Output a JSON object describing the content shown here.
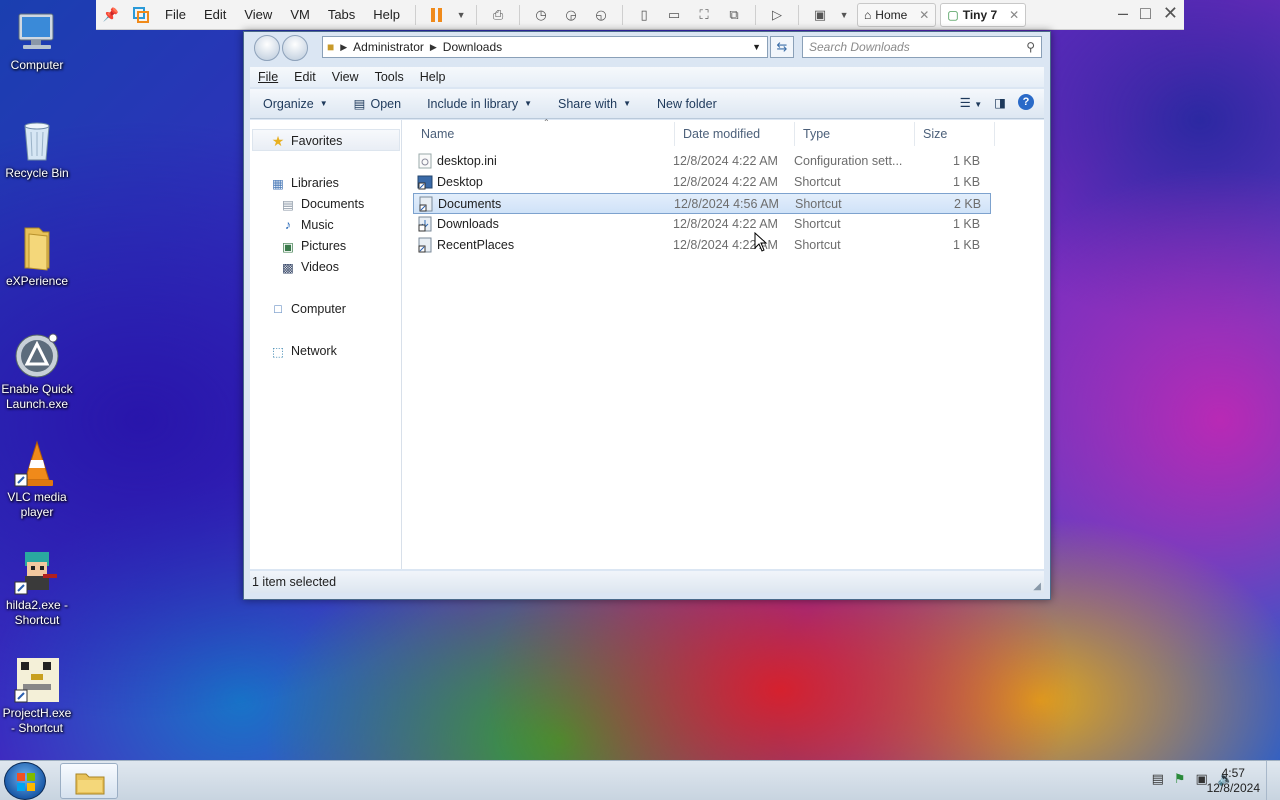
{
  "desktop_icons": [
    {
      "label": "Computer"
    },
    {
      "label": "Recycle Bin"
    },
    {
      "label": "eXPerience"
    },
    {
      "label": "Enable Quick Launch.exe"
    },
    {
      "label": "VLC media player"
    },
    {
      "label": "hilda2.exe - Shortcut"
    },
    {
      "label": "ProjectH.exe - Shortcut"
    }
  ],
  "vm_toolbar": {
    "menus": [
      "File",
      "Edit",
      "View",
      "VM",
      "Tabs",
      "Help"
    ],
    "tabs": [
      {
        "label": "Home"
      },
      {
        "label": "Tiny 7"
      }
    ]
  },
  "explorer": {
    "breadcrumb": [
      "Administrator",
      "Downloads"
    ],
    "search_placeholder": "Search Downloads",
    "menus": [
      "File",
      "Edit",
      "View",
      "Tools",
      "Help"
    ],
    "commands": [
      "Organize",
      "Open",
      "Include in library",
      "Share with",
      "New folder"
    ],
    "nav": {
      "favorites": "Favorites",
      "libraries": "Libraries",
      "library_items": [
        "Documents",
        "Music",
        "Pictures",
        "Videos"
      ],
      "computer": "Computer",
      "network": "Network"
    },
    "columns": [
      "Name",
      "Date modified",
      "Type",
      "Size"
    ],
    "files": [
      {
        "name": "desktop.ini",
        "date": "12/8/2024 4:22 AM",
        "type": "Configuration sett...",
        "size": "1 KB"
      },
      {
        "name": "Desktop",
        "date": "12/8/2024 4:22 AM",
        "type": "Shortcut",
        "size": "1 KB"
      },
      {
        "name": "Documents",
        "date": "12/8/2024 4:56 AM",
        "type": "Shortcut",
        "size": "2 KB"
      },
      {
        "name": "Downloads",
        "date": "12/8/2024 4:22 AM",
        "type": "Shortcut",
        "size": "1 KB"
      },
      {
        "name": "RecentPlaces",
        "date": "12/8/2024 4:22 AM",
        "type": "Shortcut",
        "size": "1 KB"
      }
    ],
    "status": "1 item selected"
  },
  "taskbar": {
    "time": "4:57",
    "date": "12/8/2024"
  }
}
